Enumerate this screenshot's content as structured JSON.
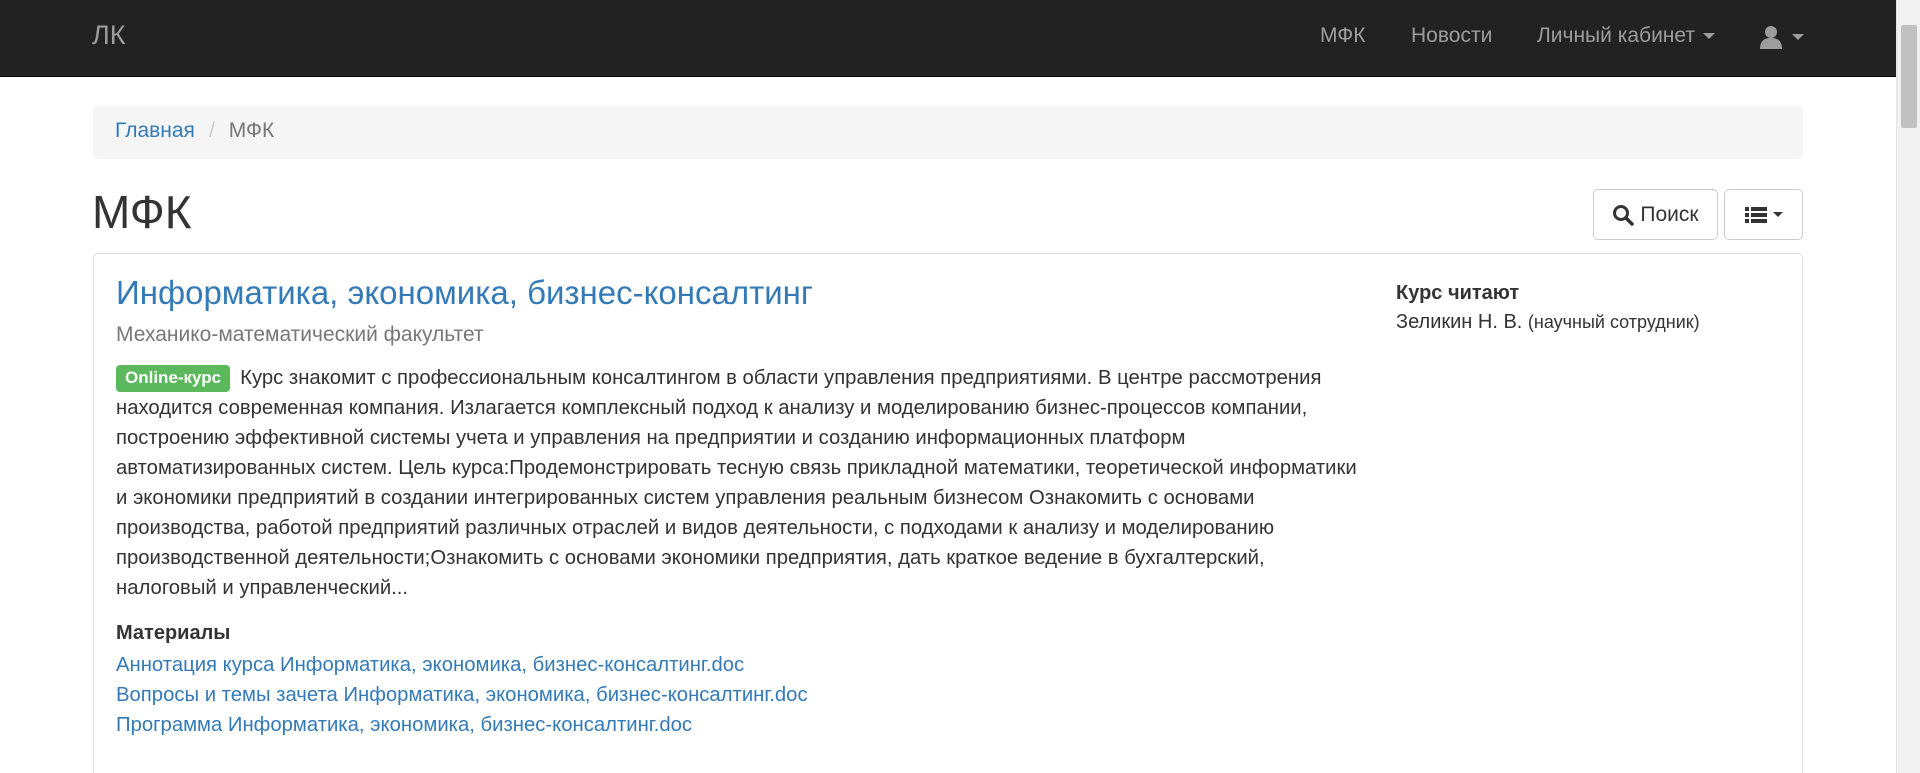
{
  "navbar": {
    "brand": "ЛК",
    "items": [
      {
        "label": "МФК"
      },
      {
        "label": "Новости"
      },
      {
        "label": "Личный кабинет"
      }
    ],
    "user_icon": "user-icon",
    "color": "#222222"
  },
  "breadcrumb": {
    "home": "Главная",
    "separator": "/",
    "current": "МФК"
  },
  "page": {
    "title": "МФК",
    "search_button": "Поиск",
    "list_icon": "list-icon"
  },
  "course": {
    "title": "Информатика, экономика, бизнес-консалтинг",
    "faculty": "Механико-математический факультет",
    "badge": "Online-курс",
    "badge_color": "#5cb85c",
    "description": "Курс знакомит с профессиональным консалтингом в области управления предприятиями. В центре рассмотрения находится современная компания. Излагается комплексный подход к анализу и моделированию бизнес-процессов компании, построению эффективной системы учета и управления на предприятии и созданию информационных платформ автоматизированных систем. Цель курса:Продемонстрировать тесную связь прикладной математики, теоретической информатики и экономики предприятий в создании интегрированных систем управления реальным бизнесом Ознакомить с основами производства, работой предприятий различных отраслей и видов деятельности, с подходами к анализу и моделированию производственной деятельности;Ознакомить с основами экономики предприятия, дать краткое ведение в бухгалтерский, налоговый и управленческий...",
    "materials_title": "Материалы",
    "materials": [
      "Аннотация курса Информатика, экономика, бизнес-консалтинг.doc",
      "Вопросы и темы зачета Информатика, экономика, бизнес-консалтинг.doc",
      "Программа Информатика, экономика, бизнес-консалтинг.doc"
    ],
    "lecturers_title": "Курс читают",
    "lecturer_name": "Зеликин Н. В.",
    "lecturer_position": "(научный сотрудник)"
  },
  "colors": {
    "link": "#337ab7",
    "muted": "#777777"
  }
}
